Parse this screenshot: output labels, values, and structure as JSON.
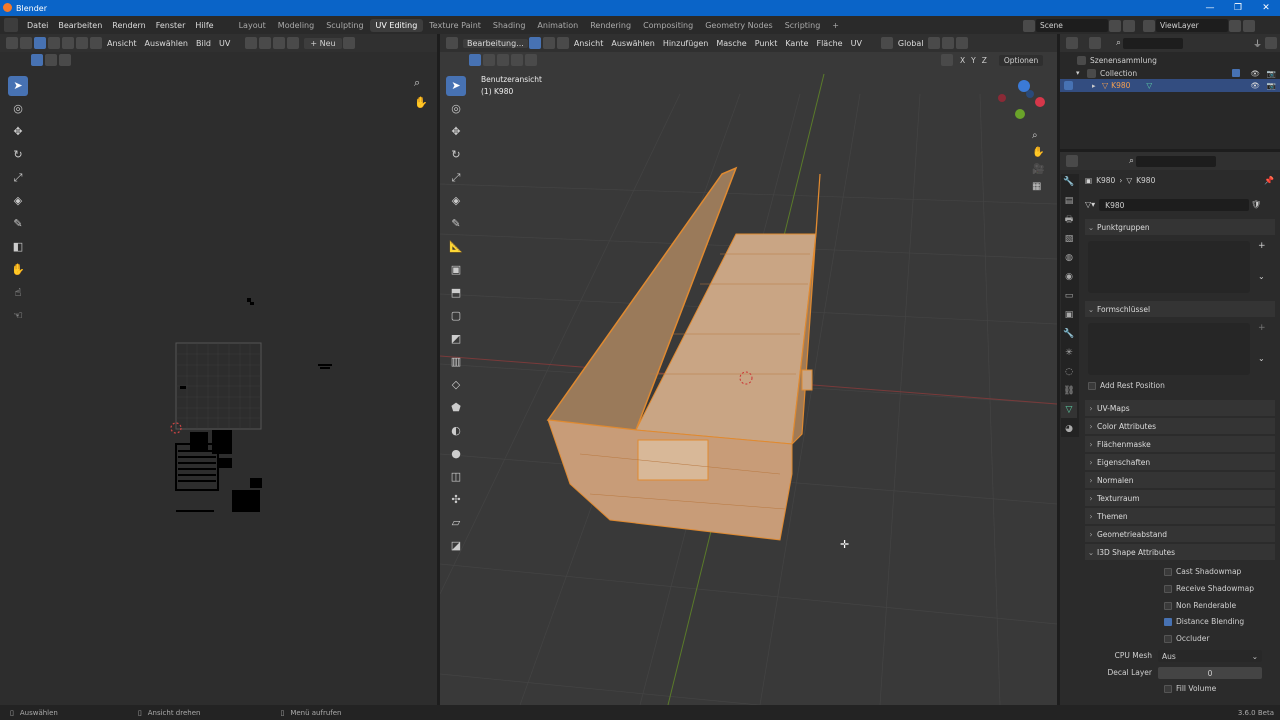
{
  "window": {
    "title": "Blender",
    "minimize": "—",
    "maximize": "❐",
    "close": "✕"
  },
  "menu": {
    "items": [
      "Datei",
      "Bearbeiten",
      "Rendern",
      "Fenster",
      "Hilfe"
    ],
    "workspaces": [
      "Layout",
      "Modeling",
      "Sculpting",
      "UV Editing",
      "Texture Paint",
      "Shading",
      "Animation",
      "Rendering",
      "Compositing",
      "Geometry Nodes",
      "Scripting"
    ],
    "add_workspace": "+",
    "scene": "Scene",
    "viewlayer": "ViewLayer"
  },
  "uv_editor": {
    "menus": [
      "Ansicht",
      "Auswählen",
      "Bild",
      "UV"
    ],
    "new_button": "+ Neu"
  },
  "viewport": {
    "mode": "Bearbeitung...",
    "menus": [
      "Ansicht",
      "Auswählen",
      "Hinzufügen",
      "Masche",
      "Punkt",
      "Kante",
      "Fläche",
      "UV"
    ],
    "orientation": "Global",
    "axes": [
      "X",
      "Y",
      "Z"
    ],
    "options": "Optionen",
    "view_name": "Benutzeransicht",
    "object_name": "(1) K980"
  },
  "outliner": {
    "root": "Szenensammlung",
    "collection": "Collection",
    "object": "K980"
  },
  "properties": {
    "breadcrumb_obj": "K980",
    "breadcrumb_mesh": "K980",
    "mesh_name": "K980",
    "sections": [
      "Punktgruppen",
      "Formschlüssel"
    ],
    "add_rest_position": "Add Rest Position",
    "collapsed": [
      "UV-Maps",
      "Color Attributes",
      "Flächenmaske",
      "Eigenschaften",
      "Normalen",
      "Texturraum",
      "Themen",
      "Geometrieabstand"
    ],
    "i3d_title": "I3D Shape Attributes",
    "i3d_checks": [
      {
        "label": "Cast Shadowmap",
        "checked": false
      },
      {
        "label": "Receive Shadowmap",
        "checked": false
      },
      {
        "label": "Non Renderable",
        "checked": false
      },
      {
        "label": "Distance Blending",
        "checked": true
      },
      {
        "label": "Occluder",
        "checked": false
      }
    ],
    "cpu_mesh_label": "CPU Mesh",
    "cpu_mesh_value": "Aus",
    "decal_layer_label": "Decal Layer",
    "decal_layer_value": "0",
    "fill_volume": "Fill Volume"
  },
  "status": {
    "select": "Auswählen",
    "rotate": "Ansicht drehen",
    "menu": "Menü aufrufen",
    "version": "3.6.0 Beta"
  }
}
